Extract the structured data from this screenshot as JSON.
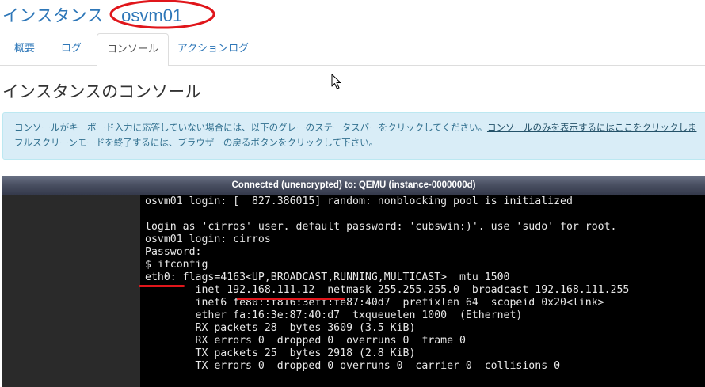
{
  "header": {
    "title": "インスタンス",
    "instance_name": "osvm01"
  },
  "tabs": [
    {
      "label": "概要",
      "active": false
    },
    {
      "label": "ログ",
      "active": false
    },
    {
      "label": "コンソール",
      "active": true
    },
    {
      "label": "アクションログ",
      "active": false
    }
  ],
  "section": {
    "title": "インスタンスのコンソール"
  },
  "alert": {
    "line1_text": "コンソールがキーボード入力に応答していない場合には、以下のグレーのステータスバーをクリックしてください。",
    "line1_link": "コンソールのみを表示するにはここをクリックしま",
    "line2_text": "フルスクリーンモードを終了するには、ブラウザーの戻るボタンをクリックして下さい。"
  },
  "console": {
    "status": "Connected (unencrypted) to: QEMU (instance-0000000d)",
    "lines": [
      "osvm01 login: [  827.386015] random: nonblocking pool is initialized",
      "",
      "login as 'cirros' user. default password: 'cubswin:)'. use 'sudo' for root.",
      "osvm01 login: cirros",
      "Password:",
      "$ ifconfig",
      "eth0: flags=4163<UP,BROADCAST,RUNNING,MULTICAST>  mtu 1500",
      "        inet 192.168.111.12  netmask 255.255.255.0  broadcast 192.168.111.255",
      "        inet6 fe80::f816:3eff:fe87:40d7  prefixlen 64  scopeid 0x20<link>",
      "        ether fa:16:3e:87:40:d7  txqueuelen 1000  (Ethernet)",
      "        RX packets 28  bytes 3609 (3.5 KiB)",
      "        RX errors 0  dropped 0  overruns 0  frame 0",
      "        TX packets 25  bytes 2918 (2.8 KiB)",
      "        TX errors 0  dropped 0 overruns 0  carrier 0  collisions 0"
    ]
  },
  "colors": {
    "link": "#2e77b8",
    "annotation_red": "#e0161b",
    "alert_bg": "#d9edf7",
    "alert_text": "#31708f"
  }
}
